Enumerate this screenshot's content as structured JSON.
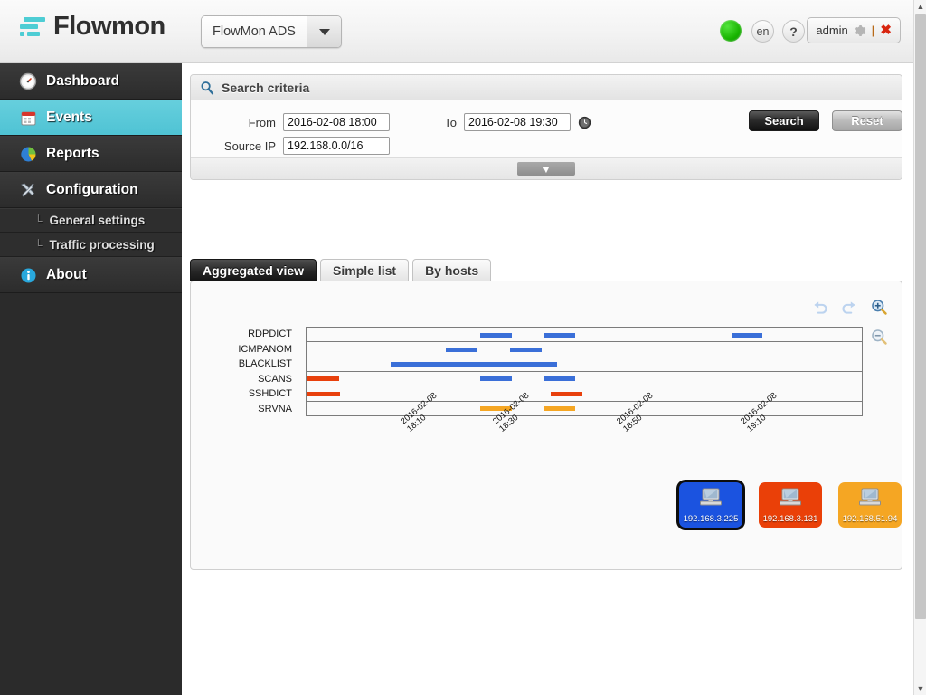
{
  "header": {
    "brand": "Flowmon",
    "module_label": "FlowMon ADS",
    "lang_label": "en",
    "help_label": "?",
    "user_label": "admin",
    "user_separator": "|",
    "close_label": "✖",
    "status_title": "system-status-ok"
  },
  "sidebar": {
    "items": [
      {
        "label": "Dashboard",
        "icon": "gauge-icon",
        "active": false
      },
      {
        "label": "Events",
        "icon": "calendar-icon",
        "active": true
      },
      {
        "label": "Reports",
        "icon": "pie-chart-icon",
        "active": false
      },
      {
        "label": "Configuration",
        "icon": "tools-icon",
        "active": false
      }
    ],
    "sub_items": [
      {
        "label": "General settings",
        "tree": "└"
      },
      {
        "label": "Traffic processing",
        "tree": "└"
      }
    ],
    "about": {
      "label": "About",
      "icon": "info-icon"
    }
  },
  "search": {
    "panel_title": "Search criteria",
    "from_label": "From",
    "from_value": "2016-02-08 18:00",
    "to_label": "To",
    "to_value": "2016-02-08 19:30",
    "source_ip_label": "Source IP",
    "source_ip_value": "192.168.0.0/16",
    "search_button": "Search",
    "reset_button": "Reset",
    "clock_icon": "clock-icon",
    "collapse_icon": "chevron-down-icon"
  },
  "tabs": [
    {
      "label": "Aggregated view",
      "active": true
    },
    {
      "label": "Simple list",
      "active": false
    },
    {
      "label": "By hosts",
      "active": false
    }
  ],
  "chart_tools": {
    "undo": "undo-icon",
    "redo": "redo-icon",
    "zoom_in": "zoom-in-icon",
    "zoom_out": "zoom-out-icon"
  },
  "colors": {
    "accent_cyan": "#4fc3d4",
    "blue": "#3a6fd8",
    "orange_red": "#e8400c",
    "amber": "#f5a623",
    "sidebar_bg": "#2b2b2b"
  },
  "hosts": [
    {
      "ip": "192.168.3.225",
      "color": "#1b53e0",
      "selected": true
    },
    {
      "ip": "192.168.3.131",
      "color": "#ea4008",
      "selected": false
    },
    {
      "ip": "192.168.51.94",
      "color": "#f5a623",
      "selected": false
    }
  ],
  "chart_data": {
    "type": "bar",
    "title": "",
    "xlabel": "",
    "ylabel": "",
    "orientation": "horizontal-timeline",
    "grid": true,
    "legend_position": "bottom-right",
    "x_axis": {
      "range": [
        "2016-02-08 18:00",
        "2016-02-08 19:30"
      ],
      "tick_labels": [
        "2016-02-08\n18:10",
        "2016-02-08\n18:30",
        "2016-02-08\n18:50",
        "2016-02-08\n19:10"
      ],
      "tick_positions_pct": [
        16.7,
        33.3,
        55.6,
        77.8
      ]
    },
    "categories": [
      "RDPDICT",
      "ICMPANOM",
      "BLACKLIST",
      "SCANS",
      "SSHDICT",
      "SRVNA"
    ],
    "series": [
      {
        "name": "192.168.3.225",
        "color": "#3a6fd8"
      },
      {
        "name": "192.168.3.131",
        "color": "#e8400c"
      },
      {
        "name": "192.168.51.94",
        "color": "#f5a623"
      }
    ],
    "events": [
      {
        "category": "RDPDICT",
        "host": "192.168.3.225",
        "color": "#3a6fd8",
        "start_pct": 31.3,
        "end_pct": 36.9
      },
      {
        "category": "RDPDICT",
        "host": "192.168.3.225",
        "color": "#3a6fd8",
        "start_pct": 42.8,
        "end_pct": 48.4
      },
      {
        "category": "RDPDICT",
        "host": "192.168.3.225",
        "color": "#3a6fd8",
        "start_pct": 76.5,
        "end_pct": 82.1
      },
      {
        "category": "ICMPANOM",
        "host": "192.168.3.225",
        "color": "#3a6fd8",
        "start_pct": 25.0,
        "end_pct": 30.6
      },
      {
        "category": "ICMPANOM",
        "host": "192.168.3.225",
        "color": "#3a6fd8",
        "start_pct": 36.7,
        "end_pct": 42.4
      },
      {
        "category": "BLACKLIST",
        "host": "192.168.3.225",
        "color": "#3a6fd8",
        "start_pct": 15.1,
        "end_pct": 45.1
      },
      {
        "category": "SCANS",
        "host": "192.168.3.131",
        "color": "#e8400c",
        "start_pct": 0.0,
        "end_pct": 5.8
      },
      {
        "category": "SCANS",
        "host": "192.168.3.225",
        "color": "#3a6fd8",
        "start_pct": 31.3,
        "end_pct": 36.9
      },
      {
        "category": "SCANS",
        "host": "192.168.3.225",
        "color": "#3a6fd8",
        "start_pct": 42.8,
        "end_pct": 48.4
      },
      {
        "category": "SSHDICT",
        "host": "192.168.3.131",
        "color": "#e8400c",
        "start_pct": 0.0,
        "end_pct": 6.0
      },
      {
        "category": "SSHDICT",
        "host": "192.168.3.131",
        "color": "#e8400c",
        "start_pct": 44.0,
        "end_pct": 49.6
      },
      {
        "category": "SRVNA",
        "host": "192.168.51.94",
        "color": "#f5a623",
        "start_pct": 31.3,
        "end_pct": 36.9
      },
      {
        "category": "SRVNA",
        "host": "192.168.51.94",
        "color": "#f5a623",
        "start_pct": 42.8,
        "end_pct": 48.4
      }
    ]
  },
  "scrollbar": {
    "up": "▲",
    "down": "▼"
  }
}
